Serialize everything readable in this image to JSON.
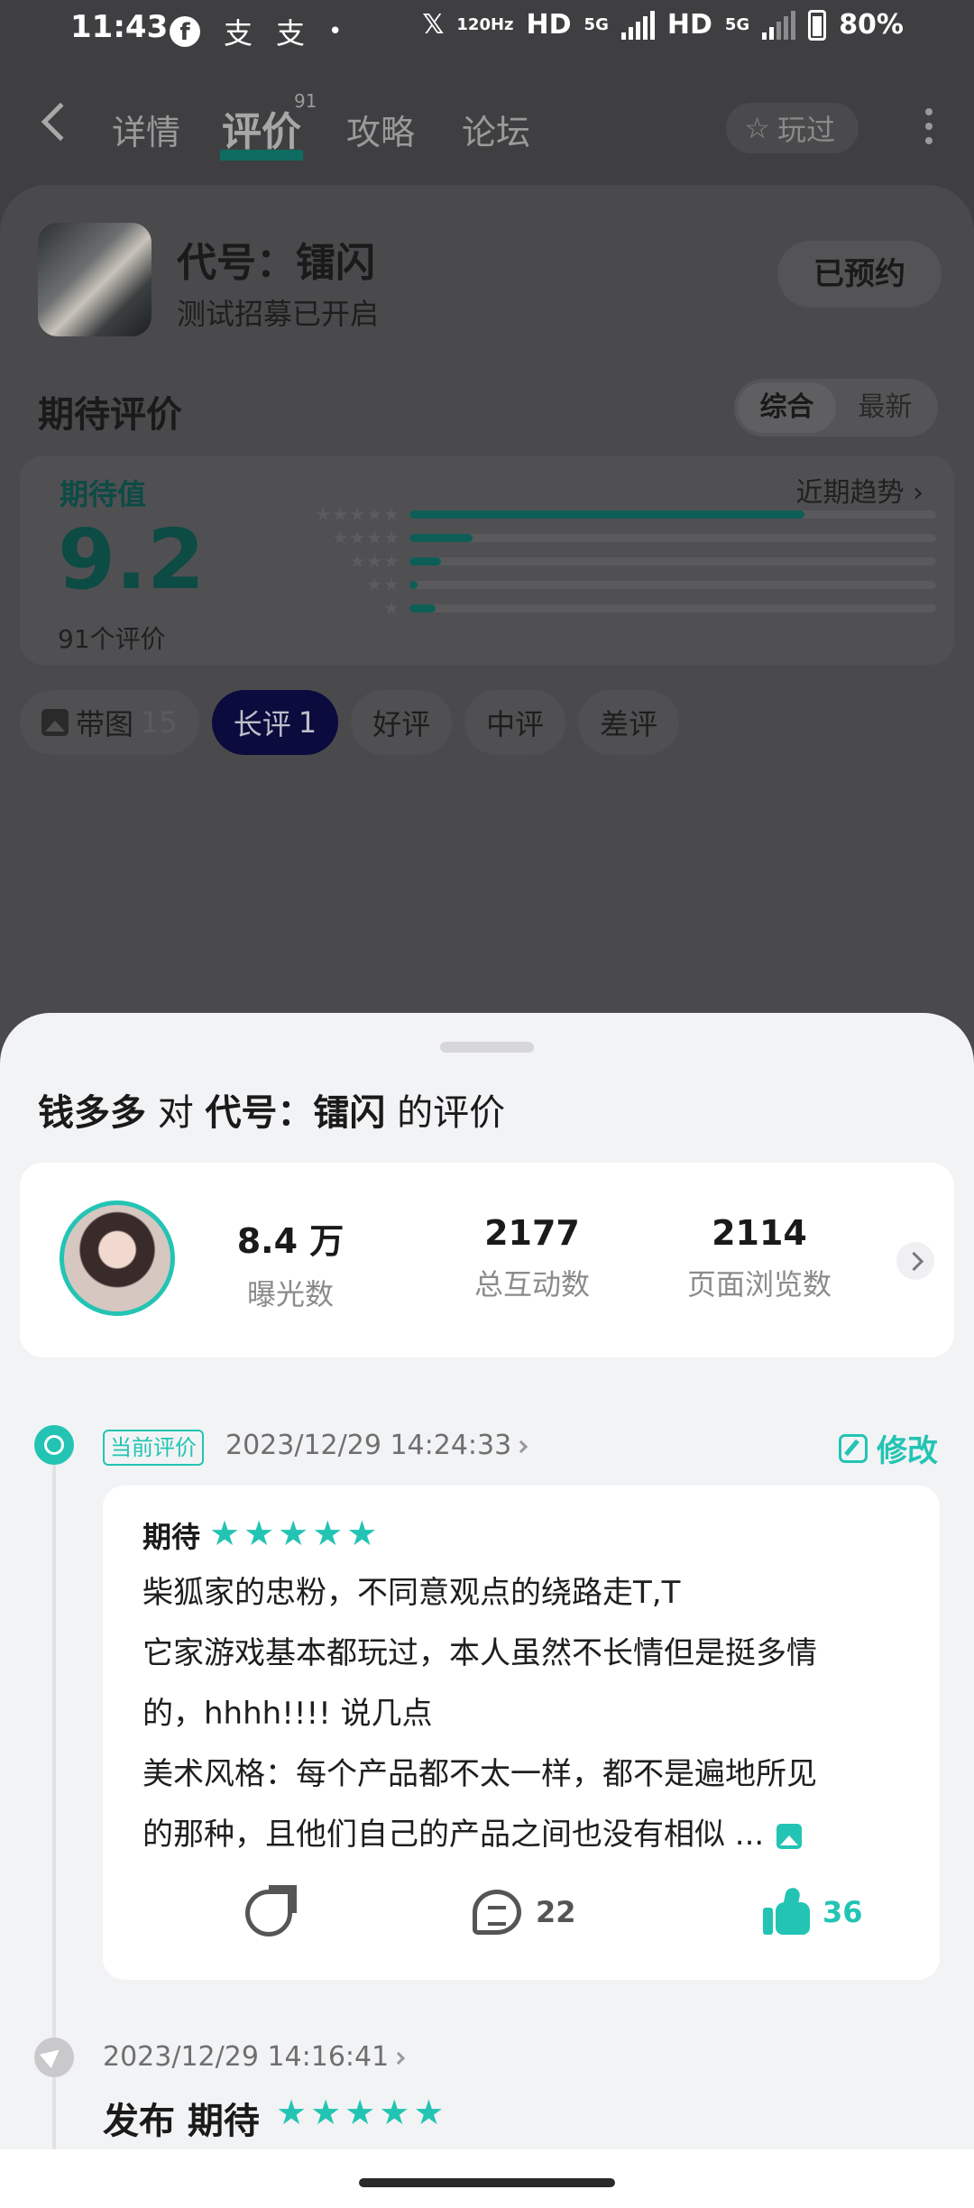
{
  "status_bar": {
    "time": "11:43",
    "glyph1": "支",
    "glyph2": "支",
    "dot": "•",
    "x_label": "𝕏",
    "hz_label": "120Hz",
    "hd1": "HD",
    "net1": "5G",
    "hd2": "HD",
    "net2": "5G",
    "battery": "80%"
  },
  "nav": {
    "tabs": [
      "详情",
      "评价",
      "攻略",
      "论坛"
    ],
    "active_index": 1,
    "review_badge": "91",
    "played_label": "玩过"
  },
  "game": {
    "title": "代号：镭闪",
    "subtitle": "测试招募已开启",
    "reserve_label": "已预约"
  },
  "rating_section": {
    "title": "期待评价",
    "sort_options": [
      "综合",
      "最新"
    ],
    "expect_label": "期待值",
    "trend_label": "近期趋势",
    "score": "9.2",
    "count_label": "91个评价",
    "distribution": [
      {
        "stars": 5,
        "fraction": 0.75
      },
      {
        "stars": 4,
        "fraction": 0.12
      },
      {
        "stars": 3,
        "fraction": 0.06
      },
      {
        "stars": 2,
        "fraction": 0.015
      },
      {
        "stars": 1,
        "fraction": 0.05
      }
    ],
    "filters": [
      {
        "label": "带图",
        "count": "15"
      },
      {
        "label": "长评",
        "count": "1"
      },
      {
        "label": "好评",
        "count": ""
      },
      {
        "label": "中评",
        "count": ""
      },
      {
        "label": "差评",
        "count": ""
      }
    ]
  },
  "sheet": {
    "title_user": "钱多多",
    "title_mid": "对",
    "title_game": "代号：镭闪",
    "title_end": "的评价",
    "stats": [
      {
        "value": "8.4 万",
        "label": "曝光数"
      },
      {
        "value": "2177",
        "label": "总互动数"
      },
      {
        "value": "2114",
        "label": "页面浏览数"
      }
    ],
    "current_badge": "当前评价",
    "current_time": "2023/12/29 14:24:33",
    "edit_label": "修改",
    "review": {
      "label": "期待",
      "stars": 5,
      "lines": [
        "柴狐家的忠粉，不同意观点的绕路走T,T",
        "它家游戏基本都玩过，本人虽然不长情但是挺多情",
        "的，hhhh!!!!  说几点",
        "美术风格：每个产品都不太一样，都不是遍地所见",
        "的那种，且他们自己的产品之间也没有相似 ..."
      ],
      "comment_count": "22",
      "like_count": "36"
    },
    "prev_time": "2023/12/29 14:16:41",
    "prev_title": "发布 期待",
    "prev_stars": 5
  },
  "colors": {
    "accent": "#23c4b3",
    "active_chip": "#0b0b3d",
    "dim_bg": "#3f3f41"
  }
}
